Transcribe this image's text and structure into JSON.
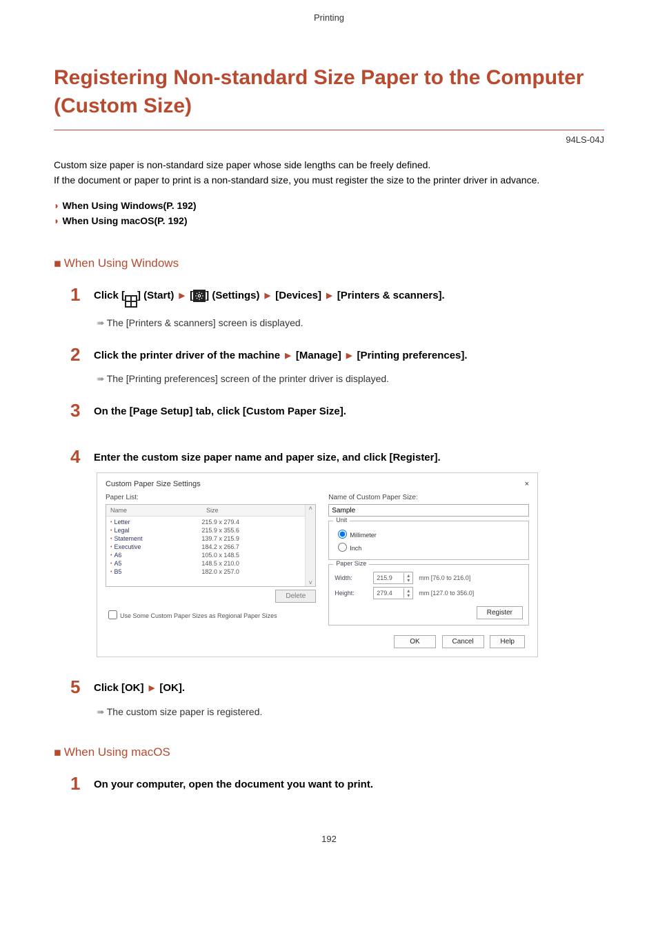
{
  "header_category": "Printing",
  "title": "Registering Non-standard Size Paper to the Computer (Custom Size)",
  "doc_code": "94LS-04J",
  "intro_line1": "Custom size paper is non-standard size paper whose side lengths can be freely defined.",
  "intro_line2": "If the document or paper to print is a non-standard size, you must register the size to the printer driver in advance.",
  "toc": {
    "windows": "When Using Windows(P. 192)",
    "macos": "When Using macOS(P. 192)"
  },
  "section_windows": "When Using Windows",
  "section_macos": "When Using macOS",
  "steps_windows": {
    "s1": {
      "pre": "Click [",
      "start_alt": "Start",
      "mid1": "] (Start) ",
      "settings_alt": "Settings",
      "mid2": " [",
      "mid3": "] (Settings) ",
      "devices": " [Devices] ",
      "printers": " [Printers & scanners].",
      "note": "The [Printers & scanners] screen is displayed."
    },
    "s2": {
      "text_a": "Click the printer driver of the machine ",
      "manage": " [Manage] ",
      "pref": " [Printing preferences].",
      "note": "The [Printing preferences] screen of the printer driver is displayed."
    },
    "s3": "On the [Page Setup] tab, click [Custom Paper Size].",
    "s4": "Enter the custom size paper name and paper size, and click [Register].",
    "s5": {
      "a": "Click [OK] ",
      "b": " [OK].",
      "note": "The custom size paper is registered."
    }
  },
  "steps_macos": {
    "s1": "On your computer, open the document you want to print."
  },
  "dialog": {
    "title": "Custom Paper Size Settings",
    "close": "×",
    "paper_list_label": "Paper List:",
    "col_name": "Name",
    "col_size": "Size",
    "rows": [
      {
        "name": "Letter",
        "size": "215.9 x 279.4"
      },
      {
        "name": "Legal",
        "size": "215.9 x 355.6"
      },
      {
        "name": "Statement",
        "size": "139.7 x 215.9"
      },
      {
        "name": "Executive",
        "size": "184.2 x 266.7"
      },
      {
        "name": "A6",
        "size": "105.0 x 148.5"
      },
      {
        "name": "A5",
        "size": "148.5 x 210.0"
      },
      {
        "name": "B5",
        "size": "182.0 x 257.0"
      }
    ],
    "delete_btn": "Delete",
    "regional_chk": "Use Some Custom Paper Sizes as Regional Paper Sizes",
    "name_label": "Name of Custom Paper Size:",
    "name_value": "Sample",
    "unit_group": "Unit",
    "unit_mm": "Millimeter",
    "unit_in": "Inch",
    "ps_group": "Paper Size",
    "width_label": "Width:",
    "width_value": "215.9",
    "width_range": "mm [76.0 to 216.0]",
    "height_label": "Height:",
    "height_value": "279.4",
    "height_range": "mm [127.0 to 356.0]",
    "register_btn": "Register",
    "ok_btn": "OK",
    "cancel_btn": "Cancel",
    "help_btn": "Help"
  },
  "page_number": "192"
}
